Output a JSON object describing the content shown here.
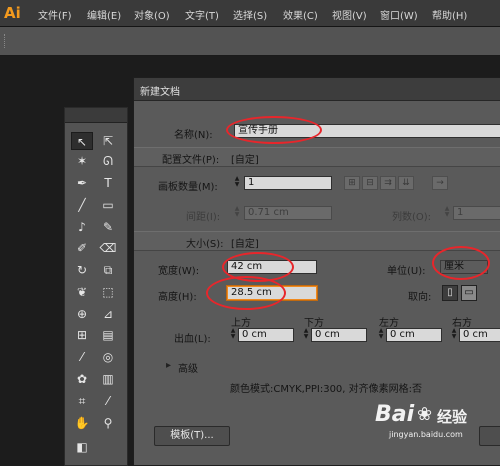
{
  "app": {
    "logo": "Ai"
  },
  "menubar": {
    "items": [
      "文件(F)",
      "编辑(E)",
      "对象(O)",
      "文字(T)",
      "选择(S)",
      "效果(C)",
      "视图(V)",
      "窗口(W)",
      "帮助(H)"
    ]
  },
  "tools_icons": [
    "selection-icon",
    "direct-selection-icon",
    "magic-wand-icon",
    "lasso-icon",
    "pen-icon",
    "type-icon",
    "line-icon",
    "rectangle-icon",
    "paintbrush-icon",
    "pencil-icon",
    "blob-brush-icon",
    "eraser-icon",
    "rotate-icon",
    "scale-icon",
    "warp-icon",
    "free-transform-icon",
    "shape-builder-icon",
    "perspective-icon",
    "mesh-icon",
    "gradient-icon",
    "eyedropper-icon",
    "blend-icon",
    "symbol-sprayer-icon",
    "column-graph-icon",
    "artboard-icon",
    "slice-icon",
    "hand-icon",
    "zoom-icon"
  ],
  "dialog": {
    "title": "新建文档",
    "name_label": "名称(N):",
    "name_value": "宣传手册",
    "profile_label": "配置文件(P):",
    "profile_value": "[自定]",
    "artboards_label": "画板数量(M):",
    "artboards_value": "1",
    "spacing_label": "间距(I):",
    "spacing_value": "0.71 cm",
    "columns_label": "列数(O):",
    "columns_value": "1",
    "size_label": "大小(S):",
    "size_value": "[自定]",
    "width_label": "宽度(W):",
    "width_value": "42 cm",
    "units_label": "单位(U):",
    "units_value": "厘米",
    "height_label": "高度(H):",
    "height_value": "28.5 cm",
    "orientation_label": "取向:",
    "bleed_label": "出血(L):",
    "bleed_headers": [
      "上方",
      "下方",
      "左方",
      "右方"
    ],
    "bleed_values": [
      "0 cm",
      "0 cm",
      "0 cm",
      "0 cm"
    ],
    "advanced_label": "高级",
    "color_info": "颜色模式:CMYK,PPI:300, 对齐像素网格:否",
    "templates_button": "模板(T)..."
  },
  "watermark": {
    "brand": "Bai",
    "brand2": "经验",
    "url": "jingyan.baidu.com"
  },
  "colors": {
    "annotation": "#e8262b",
    "logo": "#f39a1e",
    "focus": "#f08a1e"
  }
}
